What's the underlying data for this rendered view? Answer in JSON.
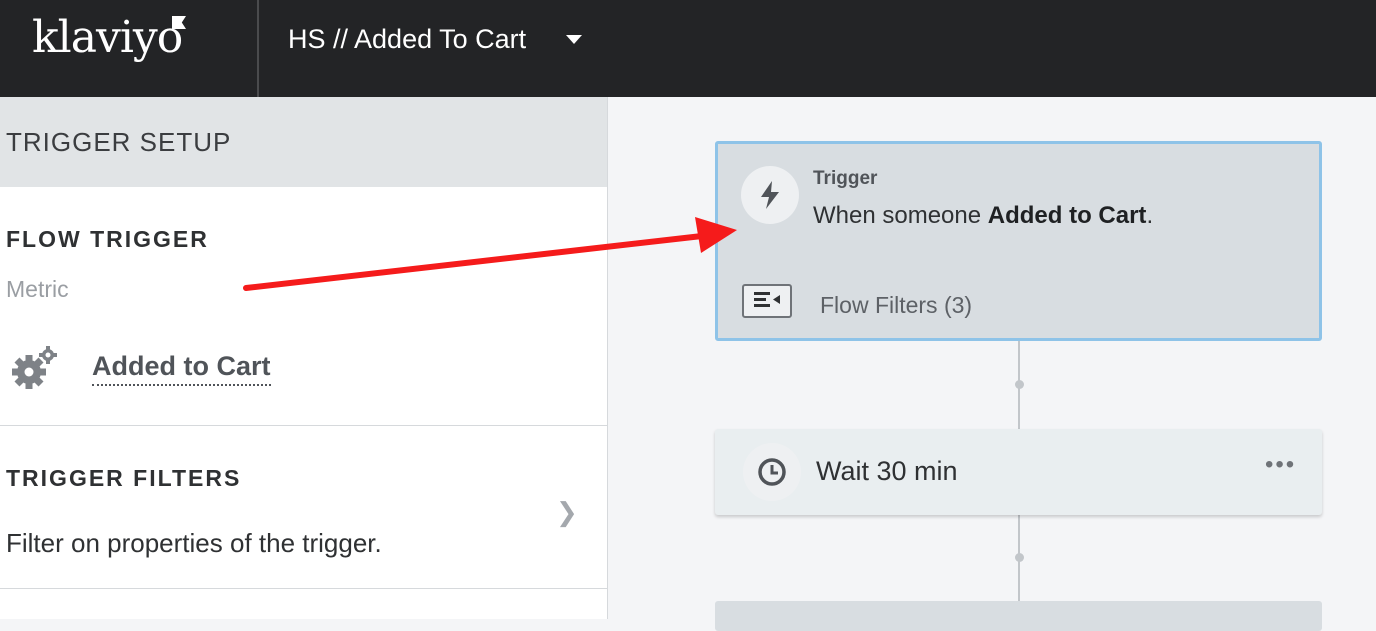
{
  "header": {
    "logo_text": "klaviyo",
    "flow_name": "HS // Added To Cart"
  },
  "sidebar": {
    "title": "TRIGGER SETUP",
    "flow_trigger": {
      "title": "FLOW TRIGGER",
      "type_label": "Metric",
      "metric_name": "Added to Cart"
    },
    "trigger_filters": {
      "title": "TRIGGER FILTERS",
      "description": "Filter on properties of the trigger."
    }
  },
  "canvas": {
    "trigger_card": {
      "label": "Trigger",
      "text_prefix": "When someone ",
      "text_metric": "Added to Cart",
      "text_suffix": ".",
      "filters_label": "Flow Filters (3)"
    },
    "wait_card": {
      "label": "Wait 30 min"
    }
  },
  "colors": {
    "topbar": "#232426",
    "trigger_border": "#8ec3e8",
    "annotation_arrow": "#f51b1b"
  }
}
